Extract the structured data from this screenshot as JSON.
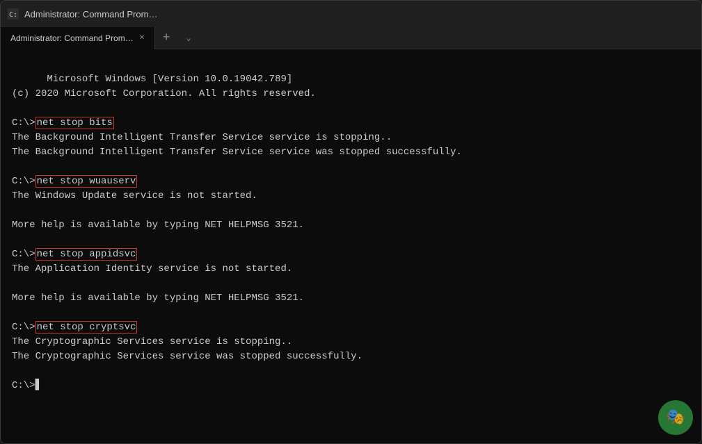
{
  "window": {
    "title": "Administrator: Command Prom…",
    "tab_label": "Administrator: Command Prom…"
  },
  "tab_bar": {
    "new_tab_label": "+",
    "dropdown_label": "⌄"
  },
  "terminal": {
    "line1": "Microsoft Windows [Version 10.0.19042.789]",
    "line2": "(c) 2020 Microsoft Corporation. All rights reserved.",
    "line3": "",
    "line4": "C:\\>",
    "cmd1": "net stop bits",
    "line5": "The Background Intelligent Transfer Service service is stopping..",
    "line6": "The Background Intelligent Transfer Service service was stopped successfully.",
    "line7": "",
    "line8": "C:\\>",
    "cmd2": "net stop wuauserv",
    "line9": "The Windows Update service is not started.",
    "line10": "",
    "line11": "More help is available by typing NET HELPMSG 3521.",
    "line12": "",
    "line13": "C:\\>",
    "cmd3": "net stop appidsvc",
    "line14": "The Application Identity service is not started.",
    "line15": "",
    "line16": "More help is available by typing NET HELPMSG 3521.",
    "line17": "",
    "line18": "C:\\>",
    "cmd4": "net stop cryptsvc",
    "line19": "The Cryptographic Services service is stopping..",
    "line20": "The Cryptographic Services service was stopped successfully.",
    "line21": "",
    "line22": "C:\\>",
    "cursor": "▋"
  }
}
